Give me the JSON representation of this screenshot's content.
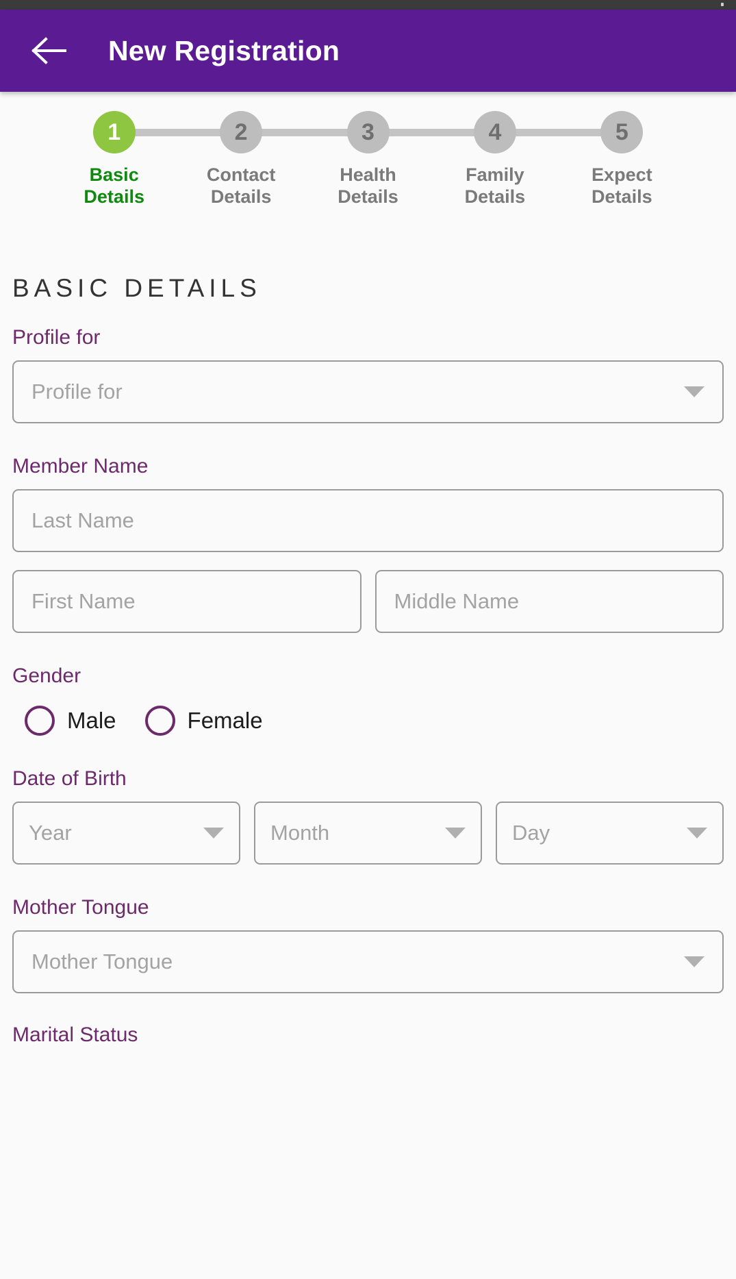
{
  "statusbar": {
    "indicator": "status-indicator"
  },
  "appbar": {
    "back_icon": "back-arrow-icon",
    "title": "New Registration"
  },
  "stepper": {
    "steps": [
      {
        "number": "1",
        "line1": "Basic",
        "line2": "Details",
        "state": "active"
      },
      {
        "number": "2",
        "line1": "Contact",
        "line2": "Details",
        "state": "inactive"
      },
      {
        "number": "3",
        "line1": "Health",
        "line2": "Details",
        "state": "inactive"
      },
      {
        "number": "4",
        "line1": "Family",
        "line2": "Details",
        "state": "inactive"
      },
      {
        "number": "5",
        "line1": "Expect",
        "line2": "Details",
        "state": "inactive"
      }
    ],
    "active_color": "#8ec641",
    "active_text_color": "#0f8a0f",
    "inactive_color": "#bdbdbd",
    "line_color": "#c4c4c4"
  },
  "form": {
    "section_title": "BASIC DETAILS",
    "profile_for": {
      "label": "Profile for",
      "placeholder": "Profile for",
      "value": ""
    },
    "member_name": {
      "label": "Member Name",
      "last_name_placeholder": "Last Name",
      "last_name_value": "",
      "first_name_placeholder": "First Name",
      "first_name_value": "",
      "middle_name_placeholder": "Middle Name",
      "middle_name_value": ""
    },
    "gender": {
      "label": "Gender",
      "options": [
        {
          "label": "Male",
          "selected": false
        },
        {
          "label": "Female",
          "selected": false
        }
      ]
    },
    "date_of_birth": {
      "label": "Date of Birth",
      "year_placeholder": "Year",
      "year_value": "",
      "month_placeholder": "Month",
      "month_value": "",
      "day_placeholder": "Day",
      "day_value": ""
    },
    "mother_tongue": {
      "label": "Mother Tongue",
      "placeholder": "Mother Tongue",
      "value": ""
    },
    "marital_status": {
      "label": "Marital Status"
    }
  },
  "colors": {
    "appbar": "#5a1b93",
    "label_purple": "#6d2a6b",
    "page_bg": "#fafafa",
    "border_gray": "#9a9a9a",
    "placeholder_gray": "#a3a3a3"
  }
}
